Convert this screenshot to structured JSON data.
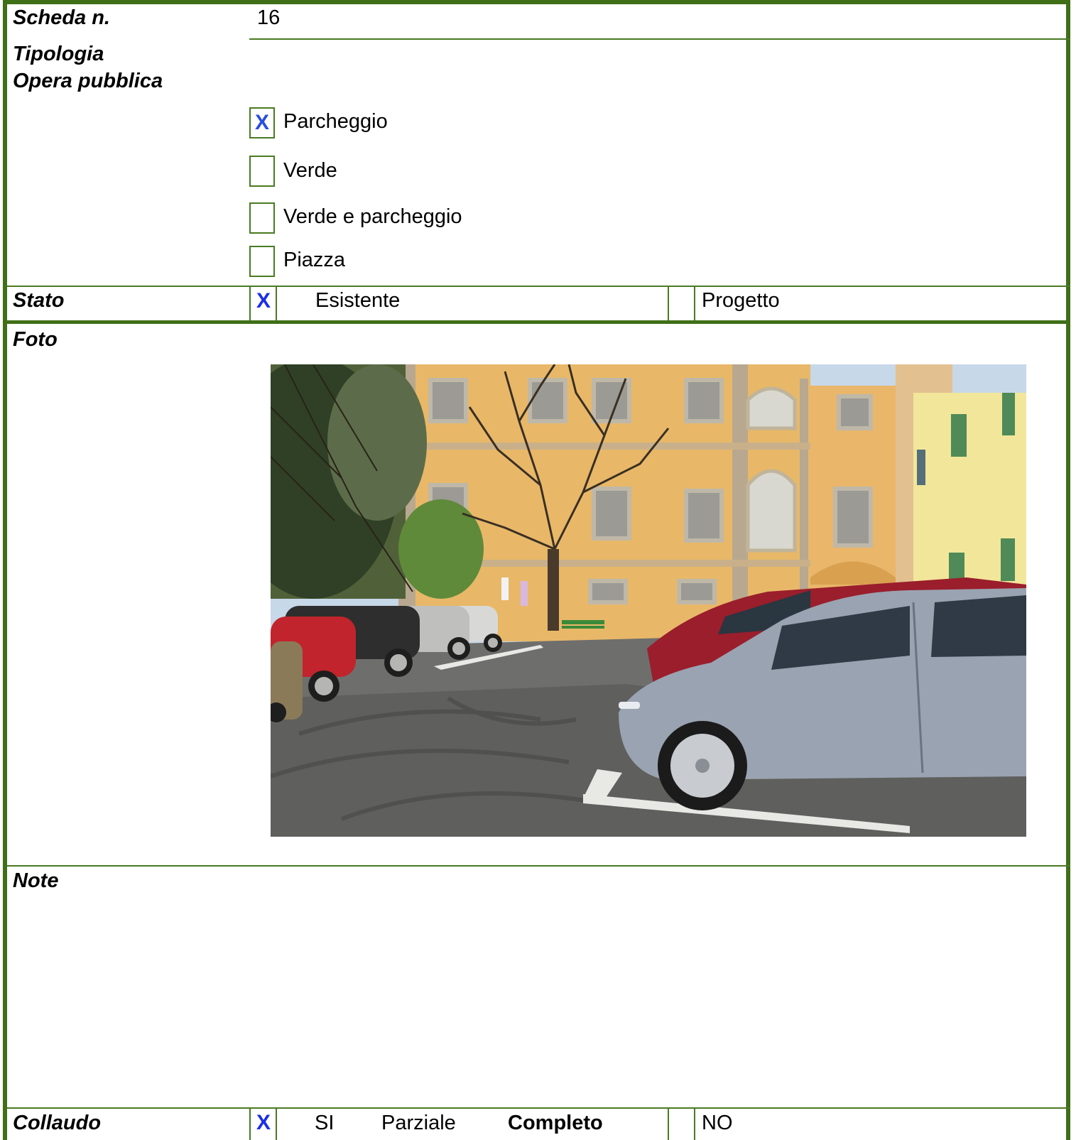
{
  "scheda": {
    "label": "Scheda n.",
    "value": "16"
  },
  "tipologia": {
    "label_line1": "Tipologia",
    "label_line2": "Opera pubblica",
    "options": [
      {
        "label": "Parcheggio",
        "checked": true,
        "mark": "X"
      },
      {
        "label": "Verde",
        "checked": false,
        "mark": ""
      },
      {
        "label": "Verde e parcheggio",
        "checked": false,
        "mark": ""
      },
      {
        "label": "Piazza",
        "checked": false,
        "mark": ""
      }
    ]
  },
  "stato": {
    "label": "Stato",
    "esistente_mark": "X",
    "esistente_label": "Esistente",
    "progetto_mark": "",
    "progetto_label": "Progetto"
  },
  "foto": {
    "label": "Foto"
  },
  "note": {
    "label": "Note",
    "text": ""
  },
  "collaudo": {
    "label": "Collaudo",
    "si_mark": "X",
    "si_label": "SI",
    "parziale_label": "Parziale",
    "completo_label": "Completo",
    "no_mark": "",
    "no_label": "NO"
  },
  "colors": {
    "border": "#3f6f17",
    "check_mark": "#1a2ee8"
  }
}
